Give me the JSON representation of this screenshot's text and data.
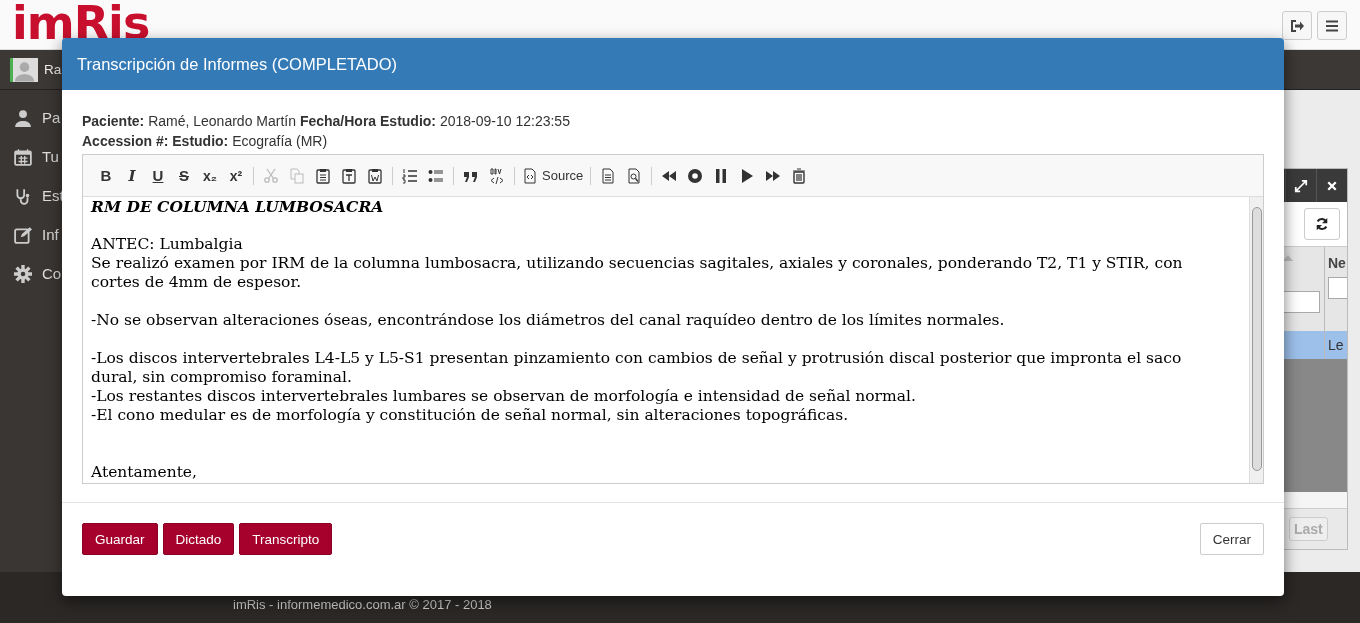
{
  "header": {
    "logo": "imRis"
  },
  "user": {
    "name": "Ra"
  },
  "sidebar": {
    "items": [
      {
        "label": "Pa"
      },
      {
        "label": "Tu"
      },
      {
        "label": "Est"
      },
      {
        "label": "Inf"
      },
      {
        "label": "Co"
      }
    ]
  },
  "side_panel": {
    "column_2": "Ne",
    "row": {
      "column_2": "Le",
      "selected": true
    },
    "pager": {
      "label": "Last",
      "disabled": true
    }
  },
  "footer": {
    "text": "imRis - informemedico.com.ar © 2017 - 2018"
  },
  "dialog": {
    "title": "Transcripción de Informes (COMPLETADO)",
    "info": [
      "**Paciente:** Ramé, Leonardo Martín **Fecha/Hora Estudio:** 2018-09-10 12:23:55",
      "**Accession #:** **Estudio:** Ecografía (MR)"
    ],
    "toolbar": [
      [
        {
          "glyph": "B",
          "disabled": false
        },
        {
          "glyph": "I",
          "disabled": false
        },
        {
          "glyph": "U",
          "disabled": false
        },
        {
          "glyph": "S",
          "disabled": false
        },
        {
          "glyph": "x₂",
          "disabled": false
        },
        {
          "glyph": "x²",
          "disabled": false
        }
      ],
      [
        {
          "disabled": true
        },
        {
          "disabled": true
        },
        {
          "disabled": false
        },
        {
          "disabled": false
        },
        {
          "disabled": false
        }
      ],
      [
        {
          "disabled": false
        },
        {
          "disabled": false
        }
      ],
      [
        {
          "disabled": false
        },
        {
          "disabled": false
        }
      ],
      [
        {
          "label": "Source",
          "disabled": false
        }
      ],
      [
        {
          "disabled": false
        },
        {
          "disabled": false
        }
      ],
      [
        {
          "disabled": false
        },
        {
          "disabled": false
        },
        {
          "disabled": false
        },
        {
          "disabled": false
        },
        {
          "disabled": false
        },
        {
          "disabled": false
        }
      ]
    ],
    "document": [
      {
        "kind": "heading",
        "lines": [
          "RM DE COLUMNA LUMBOSACRA"
        ]
      },
      {
        "kind": "paragraph",
        "lines": [
          "ANTEC: Lumbalgia",
          "Se realizó examen por IRM de la columna lumbosacra, utilizando secuencias sagitales, axiales y coronales, ponderando T2, T1 y STIR, con",
          "cortes de 4mm de espesor."
        ]
      },
      {
        "kind": "paragraph",
        "lines": [
          "-No se observan alteraciones óseas, encontrándose los diámetros del canal raquídeo dentro de los límites normales."
        ]
      },
      {
        "kind": "paragraph",
        "lines": [
          "-Los discos intervertebrales L4-L5 y L5-S1 presentan pinzamiento con cambios de señal y protrusión discal posterior que impronta el saco",
          "dural, sin compromiso foraminal.",
          "-Los restantes discos intervertebrales lumbares se observan de morfología e intensidad de señal normal.",
          "-El cono medular es de morfología y constitución de señal normal, sin alteraciones topográficas."
        ]
      },
      {
        "kind": "closing",
        "lines": [
          "Atentamente,"
        ]
      }
    ],
    "buttons": [
      {
        "label": "Guardar",
        "kind": "primary"
      },
      {
        "label": "Dictado",
        "kind": "primary"
      },
      {
        "label": "Transcripto",
        "kind": "primary"
      },
      {
        "label": "Cerrar",
        "kind": "default"
      }
    ]
  }
}
